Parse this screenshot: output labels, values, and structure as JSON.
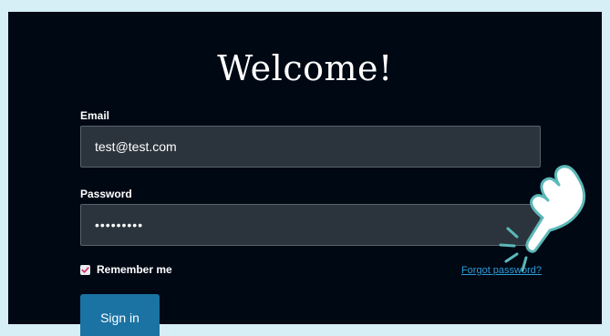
{
  "login": {
    "title": "Welcome!",
    "email_label": "Email",
    "email_value": "test@test.com",
    "password_label": "Password",
    "password_value": "•••••••••",
    "remember_label": "Remember me",
    "remember_checked": true,
    "forgot_link": "Forgot password?",
    "signin_label": "Sign in"
  },
  "icons": {
    "checkbox": "check-icon",
    "pointer": "tapping-hand-icon"
  },
  "colors": {
    "page_background": "#d6eef6",
    "panel_background": "#000814",
    "input_background": "#2b343c",
    "link": "#2b9cd8",
    "button": "#1a73a3",
    "checkbox_check": "#d9346b",
    "pointer_outline": "#5bb8b8"
  }
}
